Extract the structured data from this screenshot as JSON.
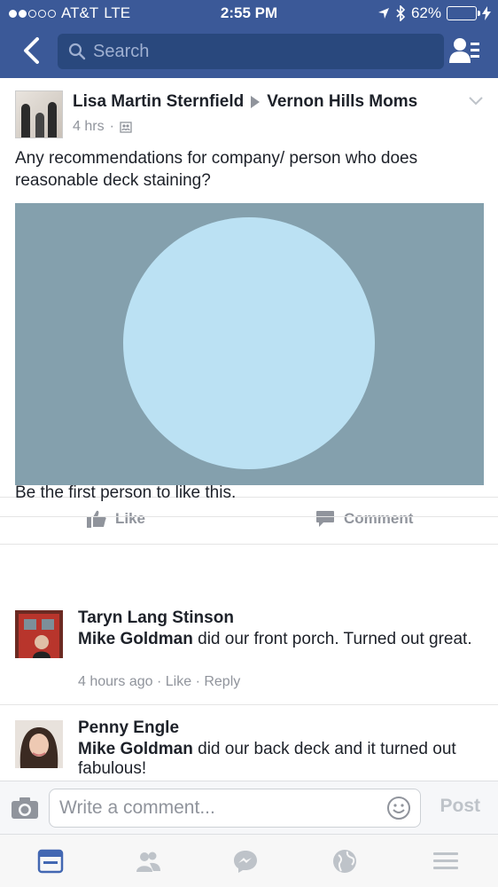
{
  "status_bar": {
    "carrier": "AT&T",
    "network": "LTE",
    "time": "2:55 PM",
    "battery": "62%",
    "battery_level": 0.62
  },
  "nav": {
    "search_placeholder": "Search"
  },
  "post": {
    "author": "Lisa Martin Sternfield",
    "group": "Vernon Hills Moms",
    "time": "4 hrs",
    "text": "Any recommendations for company/ person who does reasonable deck staining?",
    "actions": {
      "like": "Like",
      "comment": "Comment"
    },
    "likes_summary": "Be the first person to like this."
  },
  "comments": [
    {
      "name": "Taryn Lang Stinson",
      "mention": "Mike Goldman",
      "text": " did our front porch. Turned out great.",
      "time": "4 hours ago",
      "like": "Like",
      "reply": "Reply"
    },
    {
      "name": "Penny Engle",
      "mention": "Mike Goldman",
      "text": " did our back deck and it turned out fabulous!"
    }
  ],
  "composer": {
    "placeholder": "Write a comment...",
    "post_label": "Post"
  },
  "colors": {
    "brand": "#3b5998",
    "media_bg": "#84a0ad",
    "media_circle": "#bbe1f3",
    "active_tab": "#4267b2"
  }
}
